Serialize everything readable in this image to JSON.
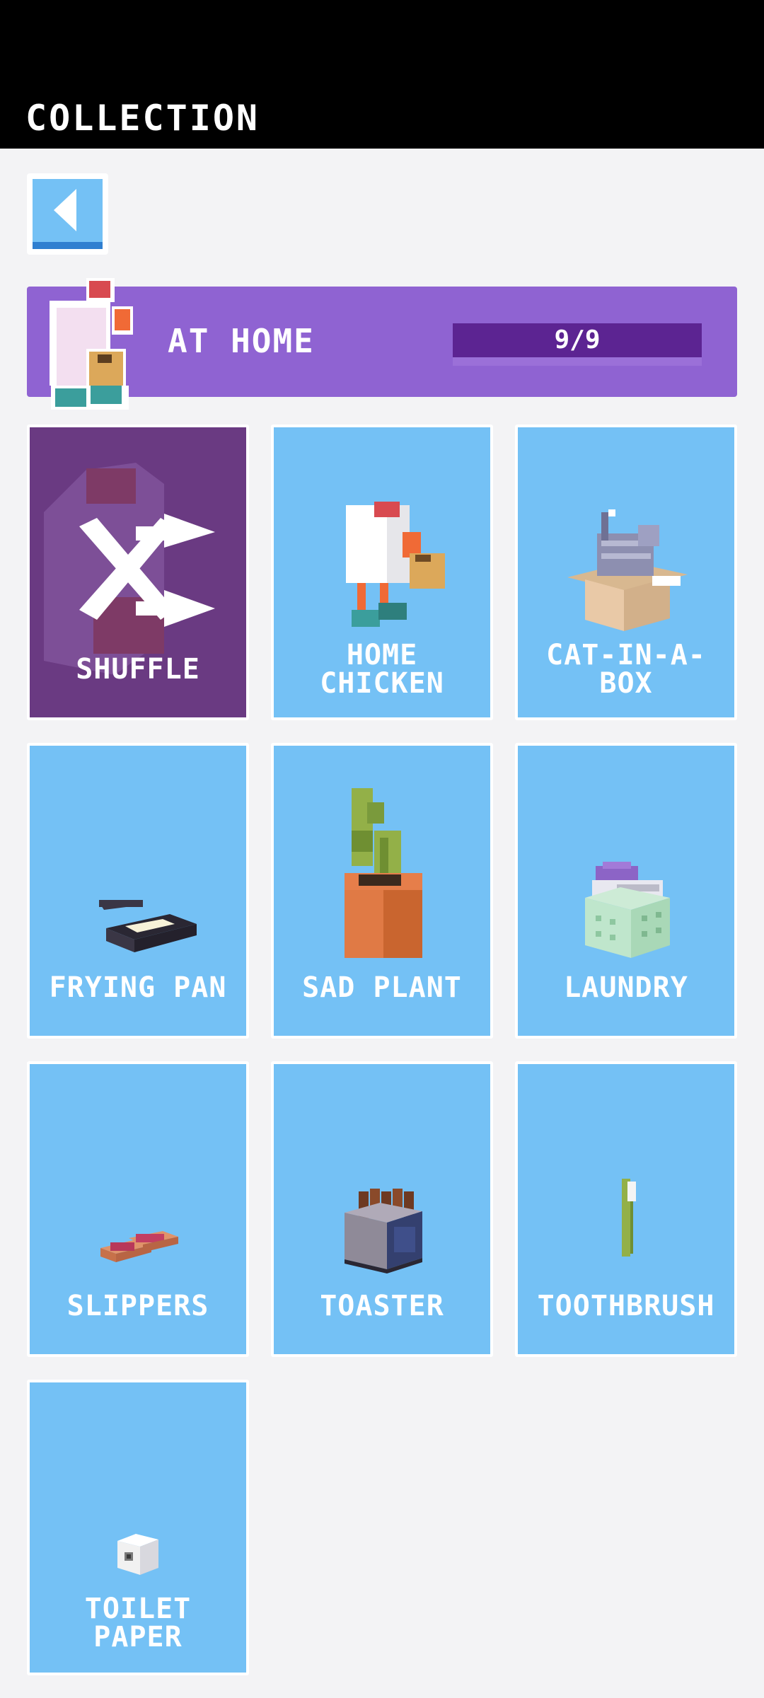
{
  "header": {
    "title": "COLLECTION"
  },
  "banner": {
    "title": "AT HOME",
    "progress_text": "9/9",
    "progress_fraction": 1.0
  },
  "colors": {
    "card_bg": "#74c1f5",
    "shuffle_bg": "#6a3a82",
    "banner_bg": "#8f63d2",
    "progress_fill": "#5c2492"
  },
  "cards": [
    {
      "label": "SHUFFLE",
      "icon": "shuffle-icon"
    },
    {
      "label": "HOME\nCHICKEN",
      "icon": "home-chicken-icon"
    },
    {
      "label": "CAT-IN-A-\nBOX",
      "icon": "cat-in-a-box-icon"
    },
    {
      "label": "FRYING PAN",
      "icon": "frying-pan-icon"
    },
    {
      "label": "SAD PLANT",
      "icon": "sad-plant-icon"
    },
    {
      "label": "LAUNDRY",
      "icon": "laundry-icon"
    },
    {
      "label": "SLIPPERS",
      "icon": "slippers-icon"
    },
    {
      "label": "TOASTER",
      "icon": "toaster-icon"
    },
    {
      "label": "TOOTHBRUSH",
      "icon": "toothbrush-icon"
    },
    {
      "label": "TOILET\nPAPER",
      "icon": "toilet-paper-icon"
    }
  ]
}
